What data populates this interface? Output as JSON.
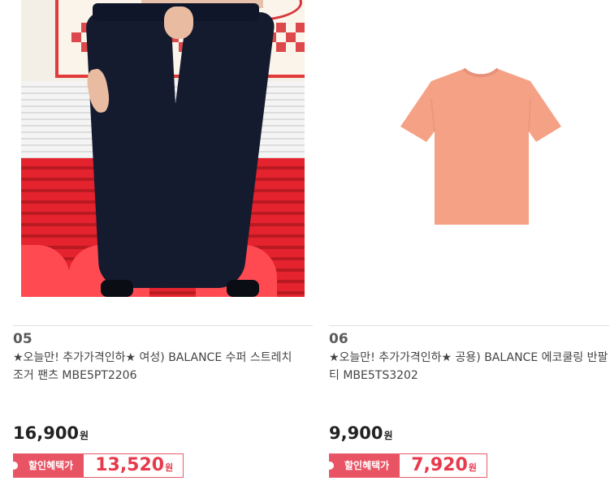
{
  "products": [
    {
      "number": "05",
      "name": "★오늘만! 추가가격인하★ 여성) BALANCE 수퍼 스트레치 조거 팬츠 MBE5PT2206",
      "price": "16,900",
      "price_unit": "원",
      "sale_label": "할인혜택가",
      "sale_price": "13,520",
      "sale_unit": "원",
      "image": "black-jogger-pants-photo"
    },
    {
      "number": "06",
      "name": "★오늘만! 추가가격인하★ 공용) BALANCE 에코쿨링 반팔 티 MBE5TS3202",
      "price": "9,900",
      "price_unit": "원",
      "sale_label": "할인혜택가",
      "sale_price": "7,920",
      "sale_unit": "원",
      "image": "salmon-tshirt-photo"
    }
  ],
  "colors": {
    "accent": "#e95465",
    "sale_text": "#e8394b",
    "tshirt": "#f5a185"
  }
}
